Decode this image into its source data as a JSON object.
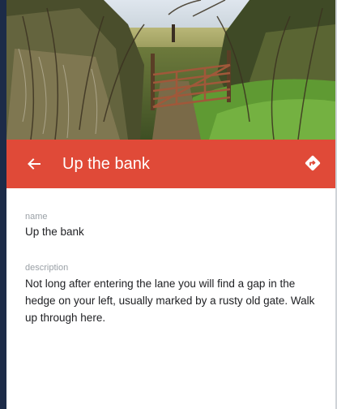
{
  "header": {
    "title": "Up the bank",
    "back_icon": "arrow-back-icon",
    "directions_icon": "directions-icon",
    "bar_color": "#e04a38"
  },
  "photo": {
    "subject": "rusty-gate-photo"
  },
  "details": {
    "name_label": "name",
    "name_value": "Up the bank",
    "description_label": "description",
    "description_value": "Not long after entering the lane you will find a gap in the hedge on your left, usually marked by a rusty old gate. Walk up through here."
  }
}
